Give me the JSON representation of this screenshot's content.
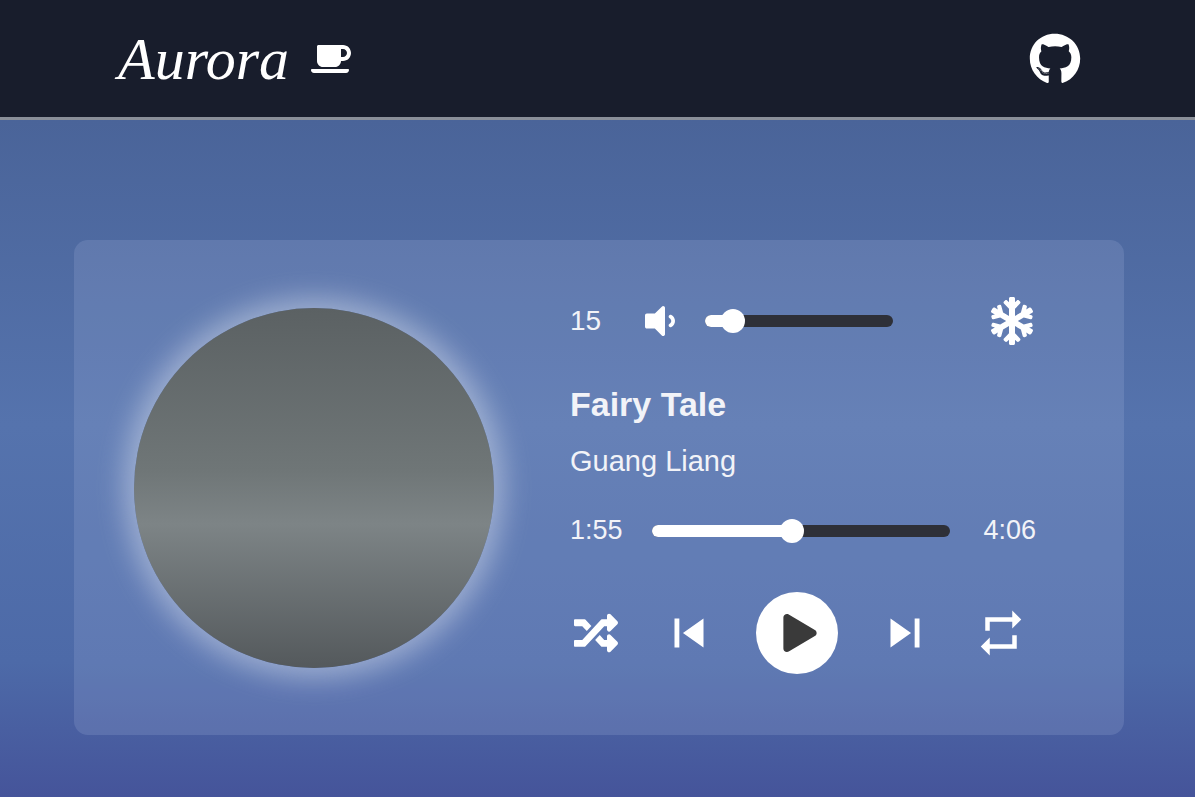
{
  "header": {
    "title": "Aurora"
  },
  "player": {
    "volume": {
      "value": "15",
      "level": 0.15
    },
    "track": {
      "title": "Fairy Tale",
      "artist": "Guang Liang"
    },
    "progress": {
      "elapsed": "1:55",
      "duration": "4:06",
      "level": 0.47
    },
    "playing": false
  }
}
